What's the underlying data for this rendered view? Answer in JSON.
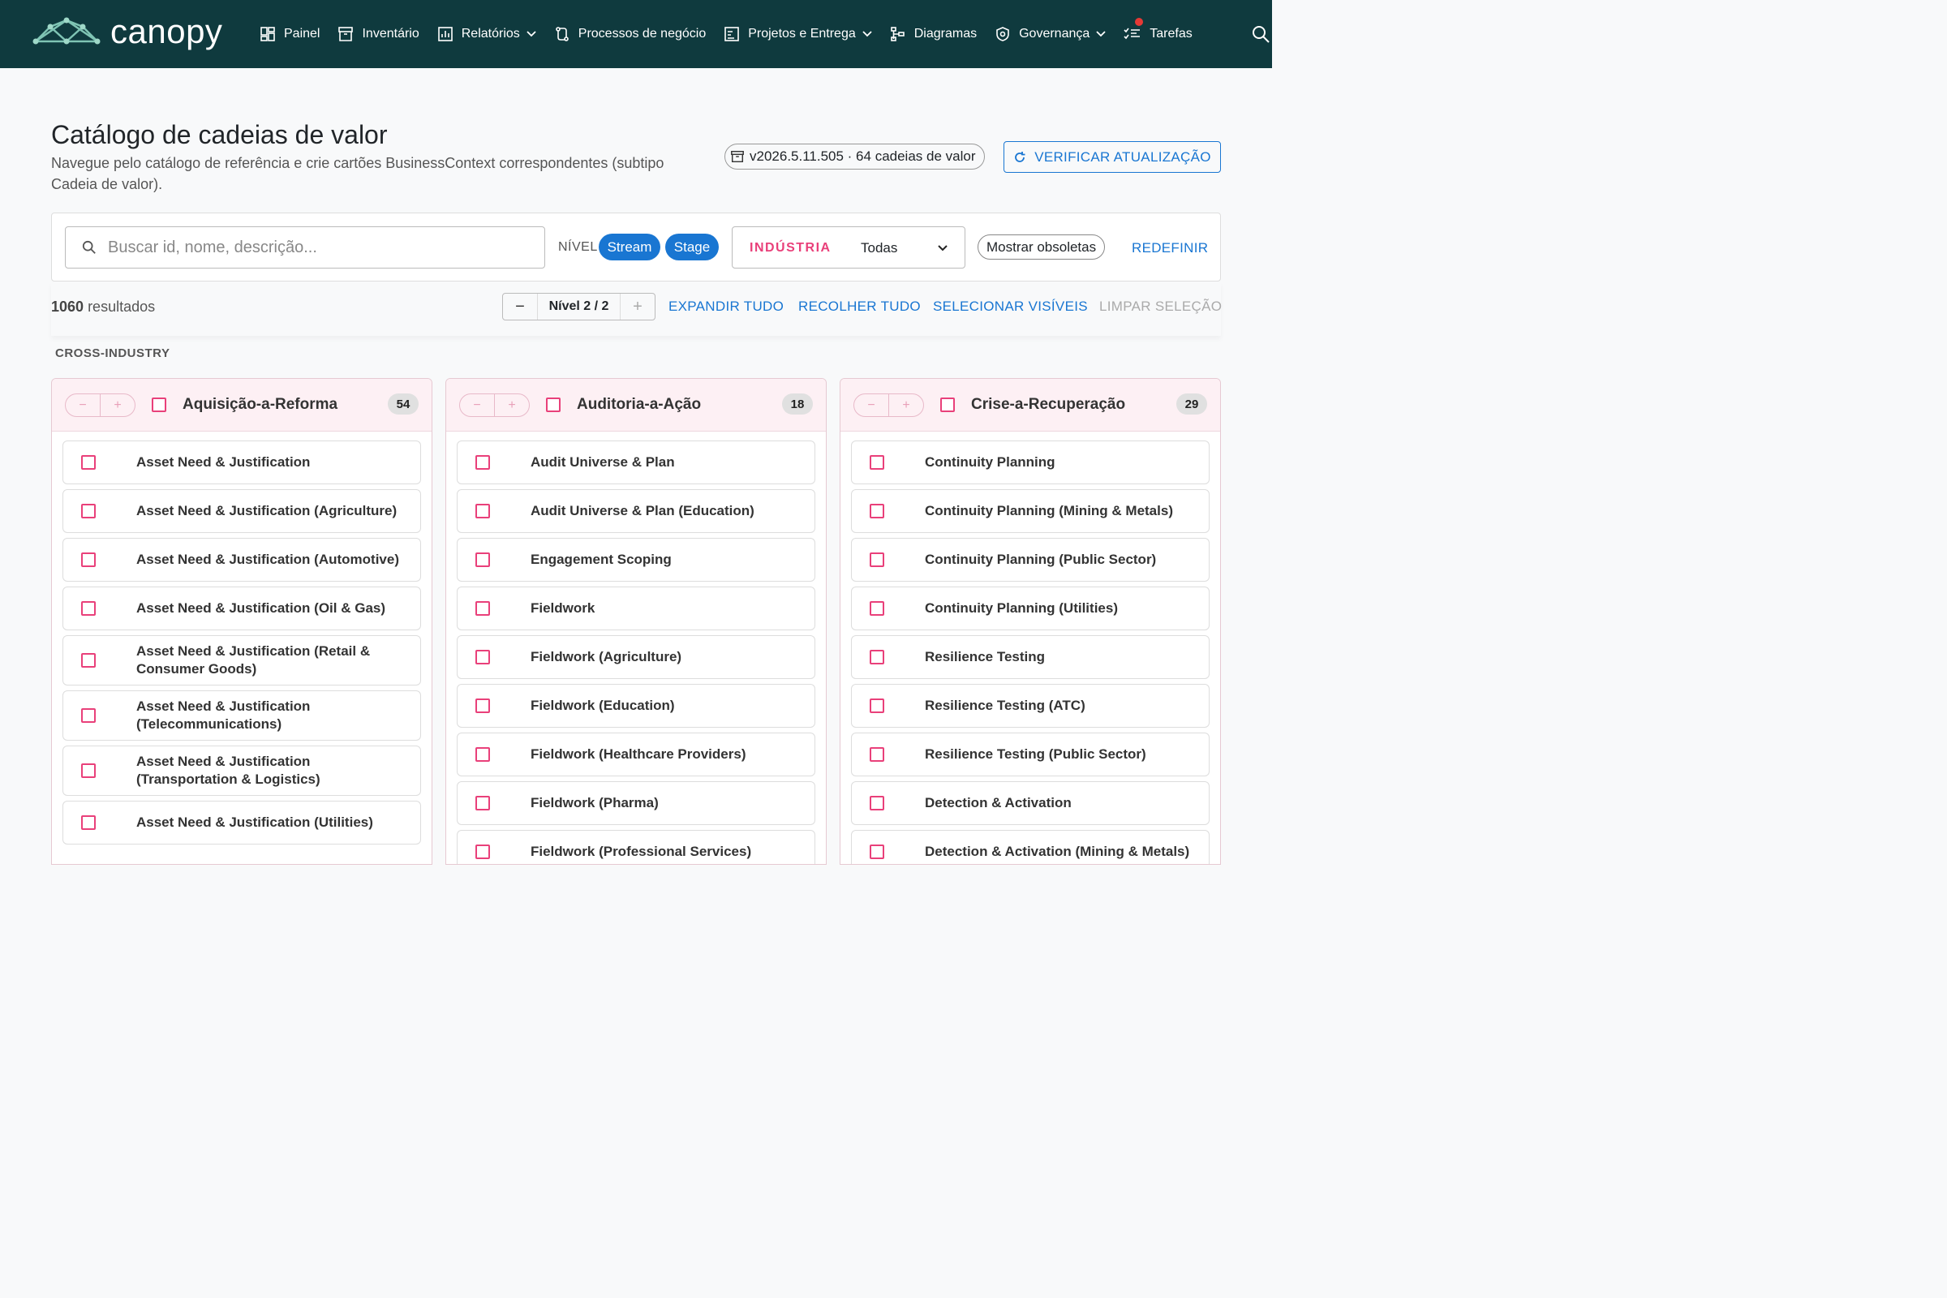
{
  "app": {
    "brand": "canopy"
  },
  "nav": {
    "items": [
      {
        "label": "Painel",
        "icon": "dashboard-icon"
      },
      {
        "label": "Inventário",
        "icon": "archive-icon"
      },
      {
        "label": "Relatórios",
        "icon": "chart-icon",
        "dropdown": true
      },
      {
        "label": "Processos de negócio",
        "icon": "process-icon"
      },
      {
        "label": "Projetos e Entrega",
        "icon": "project-icon",
        "dropdown": true
      },
      {
        "label": "Diagramas",
        "icon": "diagram-icon"
      },
      {
        "label": "Governança",
        "icon": "shield-icon",
        "dropdown": true
      },
      {
        "label": "Tarefas",
        "icon": "tasks-icon",
        "notification": true
      }
    ]
  },
  "header": {
    "title": "Catálogo de cadeias de valor",
    "subtitle": "Navegue pelo catálogo de referência e crie cartões BusinessContext correspondentes (subtipo Cadeia de valor).",
    "version": "v2026.5.11.505 · 64 cadeias de valor",
    "check_update": "VERIFICAR ATUALIZAÇÃO"
  },
  "filters": {
    "search_placeholder": "Buscar id, nome, descrição...",
    "level_label": "NÍVEL",
    "level_stream": "Stream",
    "level_stage": "Stage",
    "industry_label": "INDÚSTRIA",
    "industry_value": "Todas",
    "show_obsolete": "Mostrar obsoletas",
    "reset": "REDEFINIR"
  },
  "toolbar": {
    "results_count": "1060",
    "results_label": "resultados",
    "level_stepper": "Nível 2 / 2",
    "expand_all": "EXPANDIR TUDO",
    "collapse_all": "RECOLHER TUDO",
    "select_visible": "SELECIONAR VISÍVEIS",
    "clear_selection": "LIMPAR SELEÇÃO"
  },
  "section": {
    "label": "CROSS-INDUSTRY"
  },
  "columns": [
    {
      "title": "Aquisição-a-Reforma",
      "count": "54",
      "items": [
        "Asset Need & Justification",
        "Asset Need & Justification (Agriculture)",
        "Asset Need & Justification (Automotive)",
        "Asset Need & Justification (Oil & Gas)",
        "Asset Need & Justification (Retail & Consumer Goods)",
        "Asset Need & Justification (Telecommunications)",
        "Asset Need & Justification (Transportation & Logistics)",
        "Asset Need & Justification (Utilities)"
      ]
    },
    {
      "title": "Auditoria-a-Ação",
      "count": "18",
      "items": [
        "Audit Universe & Plan",
        "Audit Universe & Plan (Education)",
        "Engagement Scoping",
        "Fieldwork",
        "Fieldwork (Agriculture)",
        "Fieldwork (Education)",
        "Fieldwork (Healthcare Providers)",
        "Fieldwork (Pharma)",
        "Fieldwork (Professional Services)"
      ]
    },
    {
      "title": "Crise-a-Recuperação",
      "count": "29",
      "items": [
        "Continuity Planning",
        "Continuity Planning (Mining & Metals)",
        "Continuity Planning (Public Sector)",
        "Continuity Planning (Utilities)",
        "Resilience Testing",
        "Resilience Testing (ATC)",
        "Resilience Testing (Public Sector)",
        "Detection & Activation",
        "Detection & Activation (Mining & Metals)"
      ]
    }
  ]
}
